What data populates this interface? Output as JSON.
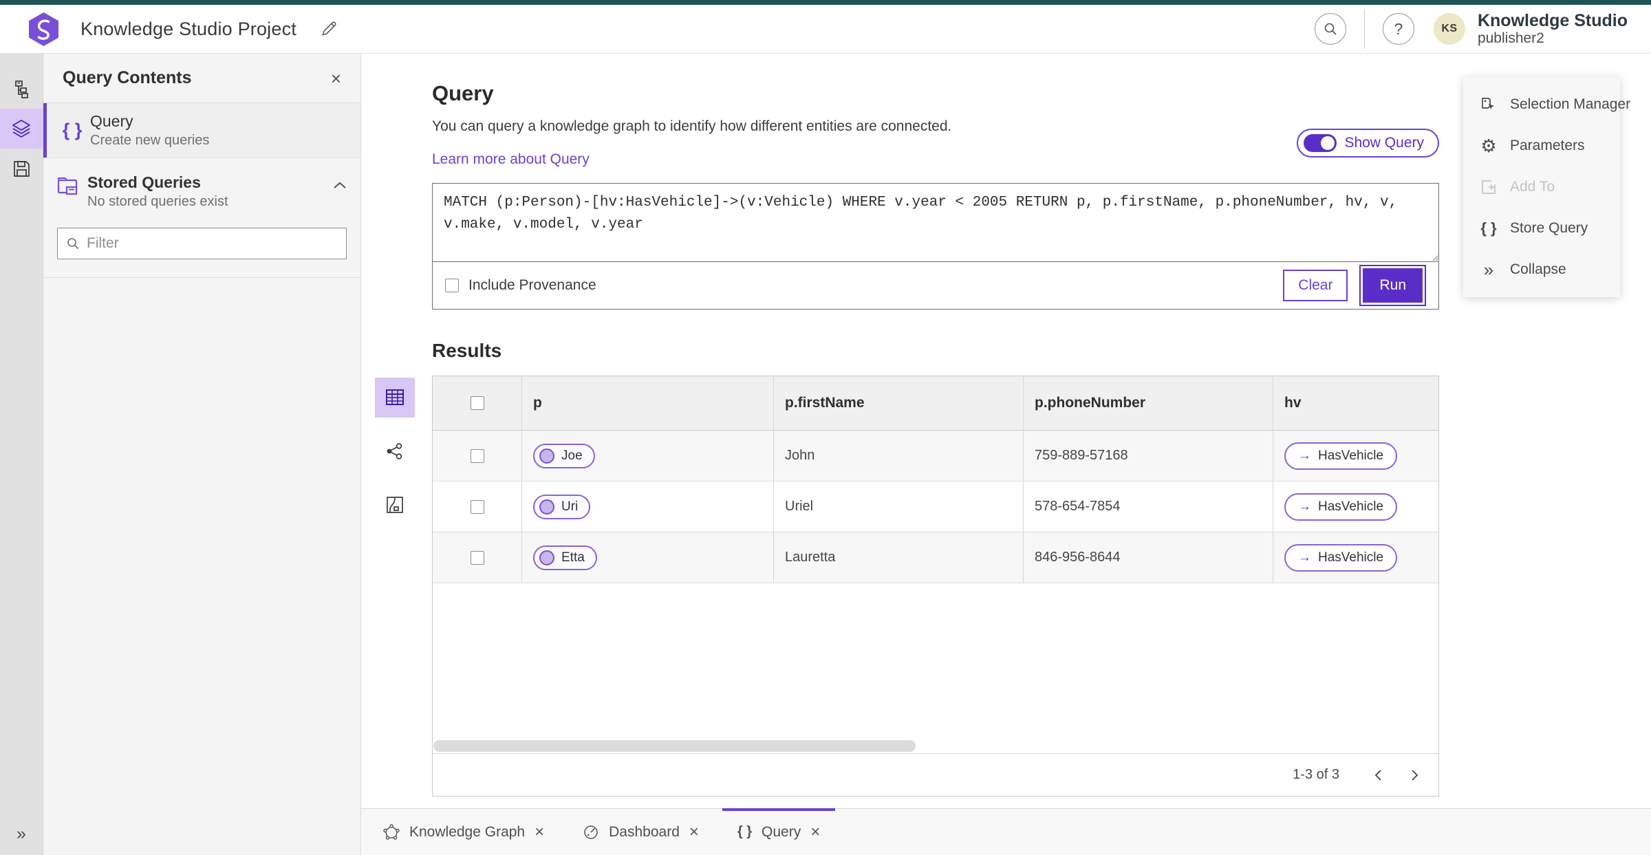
{
  "colors": {
    "accent": "#5b2dc8",
    "accent_bg": "#d9c7f7",
    "link": "#6a43d0",
    "top_strip": "#1f5456"
  },
  "glyphs": {
    "braces": "{ }",
    "collapse": "»",
    "arrow_right": "→",
    "close": "×",
    "gear": "⚙",
    "question": "?"
  },
  "header": {
    "app_title": "Knowledge Studio Project",
    "product_name": "Knowledge Studio",
    "user_name": "publisher2",
    "avatar_initials": "KS"
  },
  "contents_panel": {
    "title": "Query Contents",
    "query_item": {
      "title": "Query",
      "subtitle": "Create new queries"
    },
    "stored_queries": {
      "title": "Stored Queries",
      "subtitle": "No stored queries exist"
    },
    "filter_placeholder": "Filter"
  },
  "query_section": {
    "title": "Query",
    "description": "You can query a knowledge graph to identify how different entities are connected.",
    "learn_more_label": "Learn more about Query",
    "show_query_label": "Show Query",
    "query_text": "MATCH (p:Person)-[hv:HasVehicle]->(v:Vehicle) WHERE v.year < 2005 RETURN p, p.firstName, p.phoneNumber, hv, v, v.make, v.model, v.year",
    "include_provenance_label": "Include Provenance",
    "clear_label": "Clear",
    "run_label": "Run"
  },
  "results": {
    "title": "Results",
    "columns": [
      "p",
      "p.firstName",
      "p.phoneNumber",
      "hv"
    ],
    "rows": [
      {
        "p": "Joe",
        "firstName": "John",
        "phoneNumber": "759-889-57168",
        "hv": "HasVehicle"
      },
      {
        "p": "Uri",
        "firstName": "Uriel",
        "phoneNumber": "578-654-7854",
        "hv": "HasVehicle"
      },
      {
        "p": "Etta",
        "firstName": "Lauretta",
        "phoneNumber": "846-956-8644",
        "hv": "HasVehicle"
      }
    ],
    "pagination_label": "1-3 of 3"
  },
  "tools_panel": {
    "items": [
      {
        "label": "Selection Manager",
        "disabled": false
      },
      {
        "label": "Parameters",
        "disabled": false
      },
      {
        "label": "Add To",
        "disabled": true
      },
      {
        "label": "Store Query",
        "disabled": false
      },
      {
        "label": "Collapse",
        "disabled": false
      }
    ]
  },
  "bottom_tabs": [
    {
      "label": "Knowledge Graph",
      "active": false
    },
    {
      "label": "Dashboard",
      "active": false
    },
    {
      "label": "Query",
      "active": true
    }
  ]
}
